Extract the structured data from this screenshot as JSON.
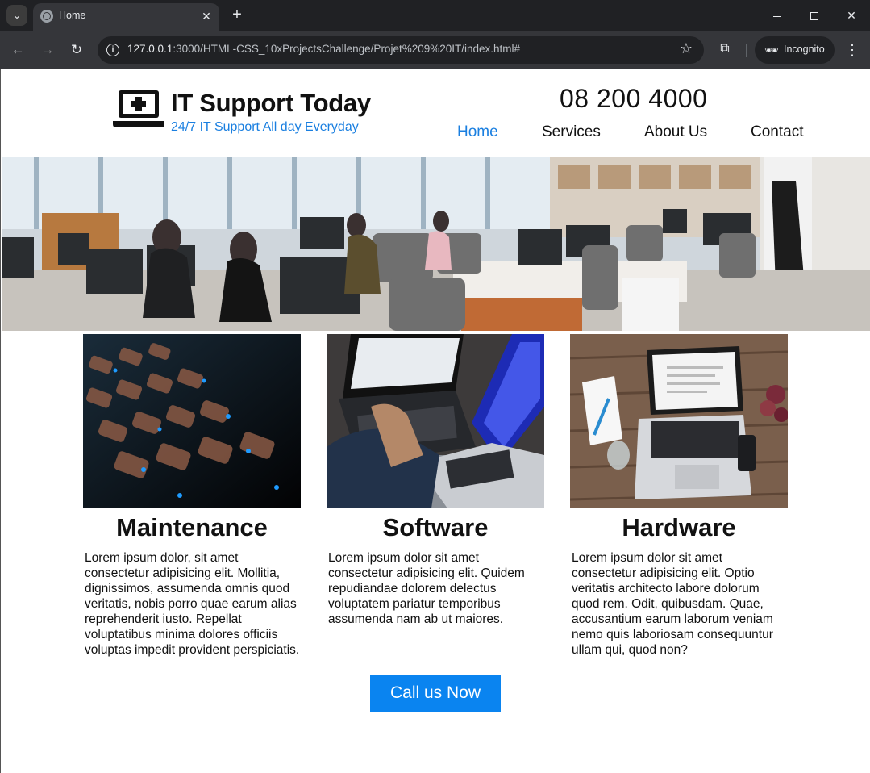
{
  "browser": {
    "tab_title": "Home",
    "url_host": "127.0.0.1",
    "url_rest": ":3000/HTML-CSS_10xProjectsChallenge/Projet%209%20IT/index.html#",
    "incognito_label": "Incognito"
  },
  "header": {
    "brand_title": "IT Support Today",
    "tagline": "24/7 IT Support All day Everyday",
    "phone": "08 200 4000"
  },
  "nav": {
    "items": [
      {
        "label": "Home",
        "active": true
      },
      {
        "label": "Services",
        "active": false
      },
      {
        "label": "About Us",
        "active": false
      },
      {
        "label": "Contact",
        "active": false
      }
    ]
  },
  "cards": [
    {
      "title": "Maintenance",
      "text": "Lorem ipsum dolor, sit amet consectetur adipisicing elit. Mollitia, dignissimos, assumenda omnis quod veritatis, nobis porro quae earum alias reprehenderit iusto. Repellat voluptatibus minima dolores officiis voluptas impedit provident perspiciatis."
    },
    {
      "title": "Software",
      "text": "Lorem ipsum dolor sit amet consectetur adipisicing elit. Quidem repudiandae dolorem delectus voluptatem pariatur temporibus assumenda nam ab ut maiores."
    },
    {
      "title": "Hardware",
      "text": "Lorem ipsum dolor sit amet consectetur adipisicing elit. Optio veritatis architecto labore dolorum quod rem. Odit, quibusdam. Quae, accusantium earum laborum veniam nemo quis laboriosam consequuntur ullam qui, quod non?"
    }
  ],
  "cta": {
    "label": "Call us Now"
  },
  "colors": {
    "accent": "#1a7fe0",
    "button": "#0a84f0"
  }
}
